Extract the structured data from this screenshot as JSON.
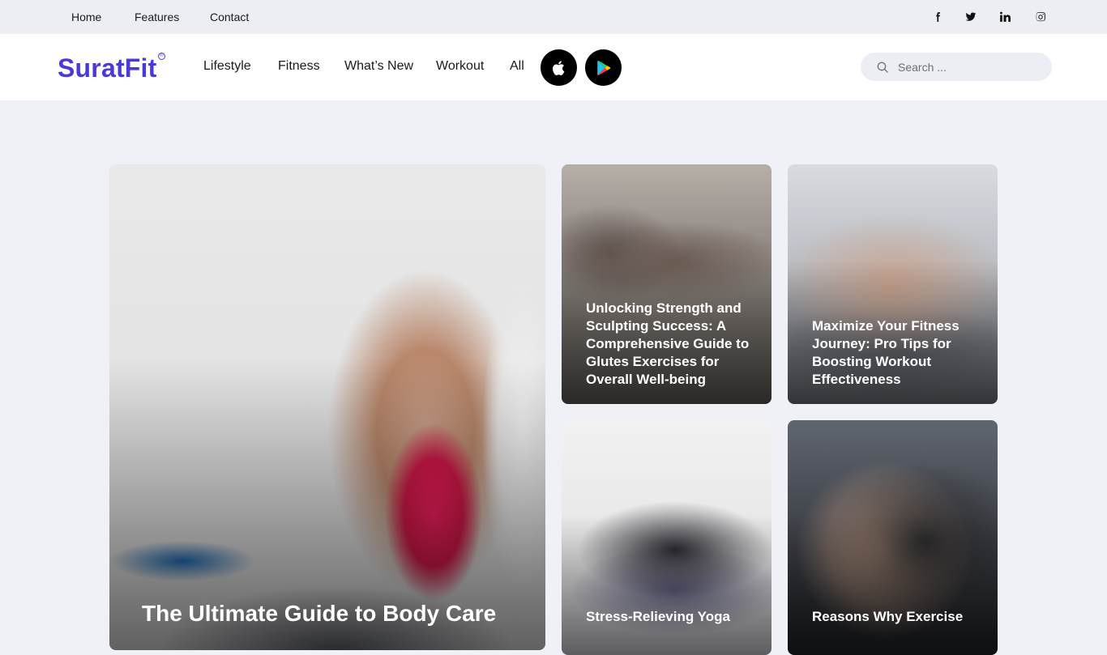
{
  "topbar": {
    "links": [
      "Home",
      "Features",
      "Contact"
    ],
    "social_icons": [
      "facebook-icon",
      "twitter-icon",
      "linkedin-icon",
      "instagram-icon"
    ]
  },
  "header": {
    "logo_text": "SuratFit",
    "logo_mark": "®",
    "nav": [
      "Lifestyle",
      "Fitness",
      "What’s New",
      "Workout",
      "All"
    ],
    "store_buttons": [
      "apple-icon",
      "google-play-icon"
    ],
    "search_placeholder": "Search ..."
  },
  "cards": [
    {
      "title": "The Ultimate Guide to Body Care"
    },
    {
      "title": "Unlocking Strength and Sculpting Success: A Comprehensive Guide to Glutes Exercises for Overall Well-being"
    },
    {
      "title": "Maximize Your Fitness Journey: Pro Tips for Boosting Workout Effectiveness"
    },
    {
      "title": "Stress-Relieving Yoga"
    },
    {
      "title": "Reasons Why Exercise"
    }
  ],
  "colors": {
    "brand": "#4b39d6",
    "page_bg": "#eff1f6",
    "topbar_bg": "#eceef3"
  }
}
